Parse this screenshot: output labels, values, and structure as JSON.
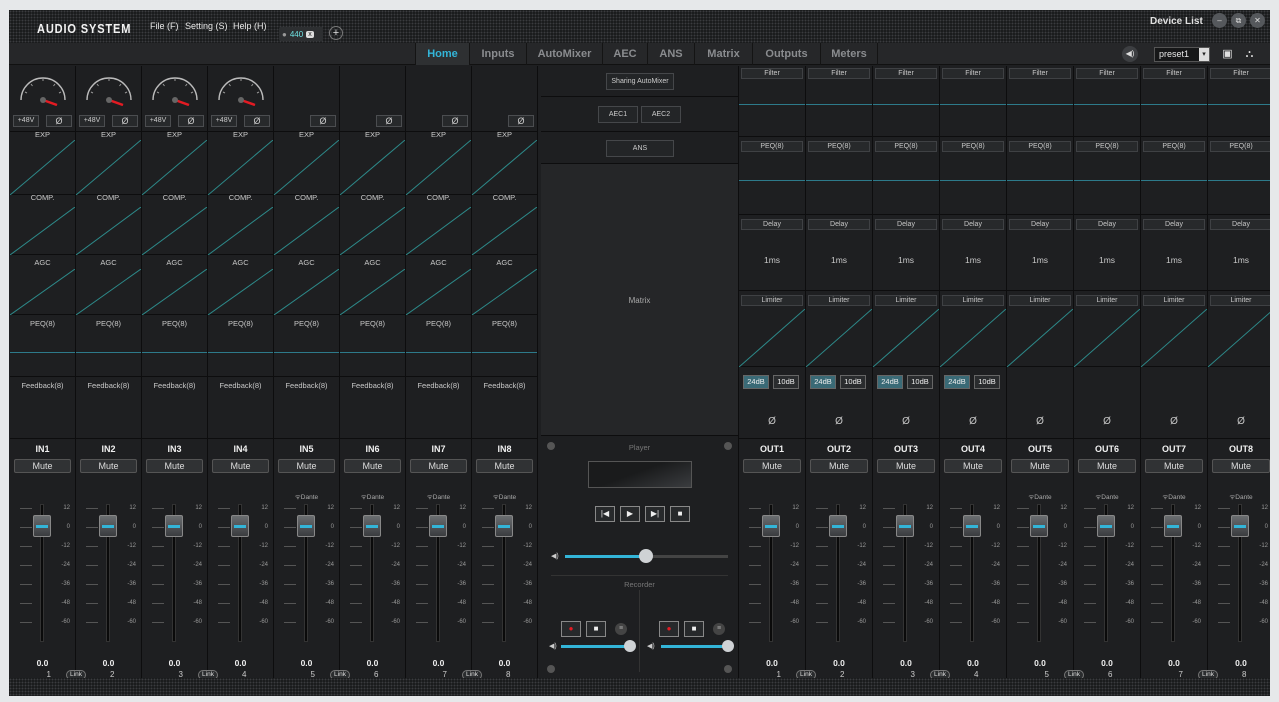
{
  "app": {
    "title": "AUDIO SYSTEM",
    "menus": [
      "File (F)",
      "Setting (S)",
      "Help (H)"
    ],
    "device_tab": "440",
    "device_tab_close": "x",
    "add_tab": "+",
    "device_list": "Device List",
    "window_buttons": [
      "–",
      "⧉",
      "✕"
    ]
  },
  "nav": {
    "tabs": [
      "Home",
      "Inputs",
      "AutoMixer",
      "AEC",
      "ANS",
      "Matrix",
      "Outputs",
      "Meters"
    ],
    "active": "Home",
    "preset": "preset1"
  },
  "inputs": {
    "phantom": "+48V",
    "phase": "Ø",
    "exp": "EXP",
    "comp": "COMP.",
    "agc": "AGC",
    "peq": "PEQ(8)",
    "feedback": "Feedback(8)",
    "mute": "Mute",
    "dante": "ᯤDante",
    "link": "Link",
    "channels": [
      {
        "name": "IN1",
        "level": "0.0",
        "num": "1"
      },
      {
        "name": "IN2",
        "level": "0.0",
        "num": "2"
      },
      {
        "name": "IN3",
        "level": "0.0",
        "num": "3"
      },
      {
        "name": "IN4",
        "level": "0.0",
        "num": "4"
      },
      {
        "name": "IN5",
        "level": "0.0",
        "num": "5"
      },
      {
        "name": "IN6",
        "level": "0.0",
        "num": "6"
      },
      {
        "name": "IN7",
        "level": "0.0",
        "num": "7"
      },
      {
        "name": "IN8",
        "level": "0.0",
        "num": "8"
      }
    ]
  },
  "fader_scale": [
    "12",
    "0",
    "-12",
    "-24",
    "-36",
    "-48",
    "-60"
  ],
  "center": {
    "sharing_automixer": "Sharing AutoMixer",
    "aec1": "AEC1",
    "aec2": "AEC2",
    "ans": "ANS",
    "matrix": "Matrix",
    "player": "Player",
    "recorder": "Recorder",
    "transport": [
      "|◀",
      "▶",
      "▶|",
      "■"
    ]
  },
  "outputs": {
    "filter": "Filter",
    "peq": "PEQ(8)",
    "delay": "Delay",
    "delay_value": "1ms",
    "limiter": "Limiter",
    "phase": "Ø",
    "mute": "Mute",
    "dante": "ᯤDante",
    "link": "Link",
    "db_a": "24dB",
    "db_b": "10dB",
    "channels": [
      {
        "name": "OUT1",
        "level": "0.0",
        "num": "1"
      },
      {
        "name": "OUT2",
        "level": "0.0",
        "num": "2"
      },
      {
        "name": "OUT3",
        "level": "0.0",
        "num": "3"
      },
      {
        "name": "OUT4",
        "level": "0.0",
        "num": "4"
      },
      {
        "name": "OUT5",
        "level": "0.0",
        "num": "5"
      },
      {
        "name": "OUT6",
        "level": "0.0",
        "num": "6"
      },
      {
        "name": "OUT7",
        "level": "0.0",
        "num": "7"
      },
      {
        "name": "OUT8",
        "level": "0.0",
        "num": "8"
      }
    ]
  },
  "colors": {
    "accent": "#33b5d8",
    "record": "#e31b23",
    "curve": "#2d8a8a"
  }
}
